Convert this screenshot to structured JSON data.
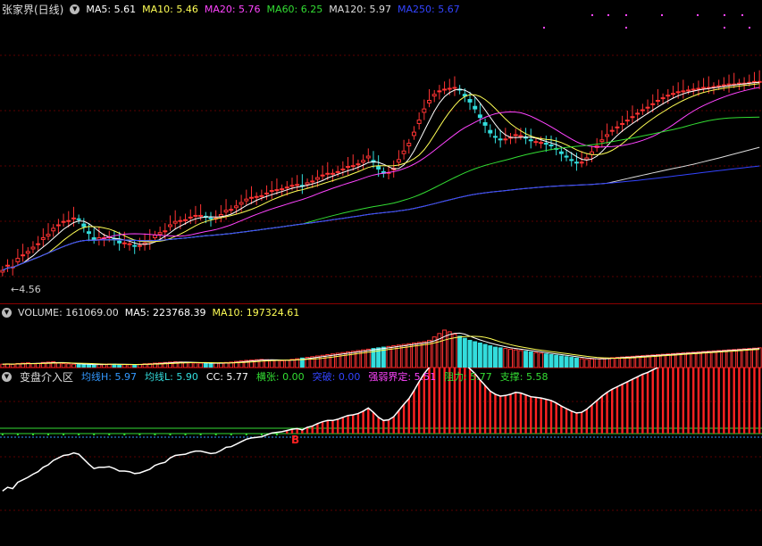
{
  "stock": {
    "title": "张家界(日线)",
    "ma": [
      {
        "label": "MA5:",
        "value": "5.61",
        "color": "#ffffff"
      },
      {
        "label": "MA10:",
        "value": "5.46",
        "color": "#ffff55"
      },
      {
        "label": "MA20:",
        "value": "5.76",
        "color": "#ff44ff"
      },
      {
        "label": "MA60:",
        "value": "6.25",
        "color": "#33dd33"
      },
      {
        "label": "MA120:",
        "value": "5.97",
        "color": "#dddddd"
      },
      {
        "label": "MA250:",
        "value": "5.67",
        "color": "#3344ff"
      }
    ],
    "low_label": "4.56"
  },
  "volume": {
    "title": "VOLUME:",
    "value": "161069.00",
    "ma5_label": "MA5:",
    "ma5_value": "223768.39",
    "ma10_label": "MA10:",
    "ma10_value": "197324.61"
  },
  "indicator": {
    "title": "变盘介入区",
    "items": [
      {
        "label": "均线H:",
        "value": "5.97",
        "color": "#3399ff"
      },
      {
        "label": "均线L:",
        "value": "5.90",
        "color": "#33dddd"
      },
      {
        "label": "CC:",
        "value": "5.77",
        "color": "#ffffff"
      },
      {
        "label": "横张:",
        "value": "0.00",
        "color": "#33dd33"
      },
      {
        "label": "突破:",
        "value": "0.00",
        "color": "#3344ff"
      },
      {
        "label": "强弱界定:",
        "value": "5.51",
        "color": "#ff44ff"
      },
      {
        "label": "阻力:",
        "value": "5.77",
        "color": "#33dd33"
      },
      {
        "label": "支撑:",
        "value": "5.58",
        "color": "#33dd33"
      }
    ],
    "signal_label": "B"
  },
  "chart_data": {
    "type": "candlestick",
    "x": [
      0,
      1,
      2,
      3,
      4,
      5,
      6,
      7,
      8,
      9,
      10,
      11,
      12,
      13,
      14,
      15,
      16,
      17,
      18,
      19,
      20,
      21,
      22,
      23,
      24,
      25,
      26,
      27,
      28,
      29,
      30,
      31,
      32,
      33,
      34,
      35,
      36,
      37,
      38,
      39,
      40,
      41,
      42,
      43,
      44,
      45,
      46,
      47,
      48,
      49,
      50,
      51,
      52,
      53,
      54,
      55,
      56,
      57,
      58,
      59,
      60,
      61,
      62,
      63,
      64,
      65,
      66,
      67,
      68,
      69,
      70,
      71,
      72,
      73,
      74,
      75,
      76,
      77,
      78,
      79,
      80,
      81,
      82,
      83,
      84,
      85,
      86,
      87,
      88,
      89,
      90,
      91,
      92,
      93,
      94,
      95,
      96,
      97,
      98,
      99,
      100,
      101,
      102,
      103,
      104,
      105,
      106,
      107,
      108,
      109,
      110,
      111,
      112,
      113,
      114,
      115,
      116,
      117,
      118,
      119,
      120,
      121,
      122,
      123,
      124,
      125,
      126,
      127,
      128,
      129,
      130,
      131,
      132,
      133,
      134,
      135,
      136,
      137,
      138,
      139,
      140,
      141,
      142,
      143,
      144,
      145,
      146,
      147,
      148,
      149
    ],
    "close": [
      4.68,
      4.74,
      4.72,
      4.82,
      4.86,
      4.9,
      4.95,
      4.99,
      5.06,
      5.1,
      5.17,
      5.21,
      5.25,
      5.26,
      5.29,
      5.27,
      5.19,
      5.11,
      5.04,
      5.06,
      5.06,
      5.07,
      5.04,
      5.0,
      5.0,
      4.99,
      4.96,
      4.97,
      5.0,
      5.03,
      5.09,
      5.12,
      5.14,
      5.21,
      5.25,
      5.26,
      5.27,
      5.3,
      5.32,
      5.32,
      5.3,
      5.28,
      5.29,
      5.33,
      5.38,
      5.39,
      5.43,
      5.47,
      5.51,
      5.53,
      5.54,
      5.55,
      5.58,
      5.61,
      5.62,
      5.63,
      5.65,
      5.67,
      5.68,
      5.66,
      5.7,
      5.72,
      5.76,
      5.79,
      5.81,
      5.81,
      5.83,
      5.86,
      5.89,
      5.9,
      5.92,
      5.96,
      6.01,
      5.94,
      5.86,
      5.81,
      5.82,
      5.87,
      5.97,
      6.07,
      6.16,
      6.29,
      6.43,
      6.56,
      6.66,
      6.73,
      6.77,
      6.79,
      6.8,
      6.81,
      6.78,
      6.71,
      6.64,
      6.56,
      6.46,
      6.37,
      6.28,
      6.23,
      6.2,
      6.21,
      6.23,
      6.26,
      6.25,
      6.22,
      6.19,
      6.18,
      6.17,
      6.15,
      6.13,
      6.09,
      6.04,
      6.0,
      5.96,
      5.93,
      5.94,
      5.99,
      6.06,
      6.13,
      6.2,
      6.26,
      6.31,
      6.35,
      6.39,
      6.43,
      6.47,
      6.51,
      6.55,
      6.58,
      6.62,
      6.66,
      6.69,
      6.72,
      6.74,
      6.76,
      6.77,
      6.78,
      6.79,
      6.8,
      6.81,
      6.81,
      6.82,
      6.83,
      6.84,
      6.85,
      6.85,
      6.86,
      6.86,
      6.87,
      6.88,
      6.88
    ],
    "open": [
      4.66,
      4.73,
      4.71,
      4.78,
      4.85,
      4.88,
      4.93,
      4.98,
      5.04,
      5.08,
      5.14,
      5.2,
      5.24,
      5.25,
      5.28,
      5.28,
      5.22,
      5.13,
      5.06,
      5.04,
      5.05,
      5.06,
      5.05,
      5.02,
      4.99,
      4.98,
      4.97,
      4.96,
      4.98,
      5.01,
      5.06,
      5.1,
      5.13,
      5.19,
      5.23,
      5.25,
      5.26,
      5.29,
      5.31,
      5.31,
      5.31,
      5.29,
      5.28,
      5.31,
      5.36,
      5.38,
      5.41,
      5.45,
      5.49,
      5.52,
      5.53,
      5.54,
      5.57,
      5.6,
      5.61,
      5.62,
      5.64,
      5.66,
      5.67,
      5.67,
      5.68,
      5.71,
      5.74,
      5.78,
      5.8,
      5.8,
      5.82,
      5.85,
      5.88,
      5.89,
      5.91,
      5.94,
      5.99,
      5.96,
      5.89,
      5.83,
      5.81,
      5.85,
      5.94,
      6.04,
      6.13,
      6.25,
      6.39,
      6.52,
      6.63,
      6.71,
      6.76,
      6.78,
      6.79,
      6.8,
      6.79,
      6.73,
      6.67,
      6.59,
      6.49,
      6.4,
      6.31,
      6.24,
      6.21,
      6.2,
      6.22,
      6.25,
      6.25,
      6.23,
      6.2,
      6.18,
      6.17,
      6.16,
      6.14,
      6.1,
      6.06,
      6.01,
      5.97,
      5.94,
      5.93,
      5.97,
      6.03,
      6.11,
      6.18,
      6.24,
      6.3,
      6.34,
      6.38,
      6.42,
      6.46,
      6.5,
      6.54,
      6.57,
      6.61,
      6.65,
      6.68,
      6.71,
      6.73,
      6.75,
      6.77,
      6.78,
      6.79,
      6.8,
      6.8,
      6.81,
      6.82,
      6.83,
      6.84,
      6.84,
      6.85,
      6.85,
      6.86,
      6.87,
      6.87,
      6.88
    ],
    "volume": [
      100,
      110,
      95,
      120,
      130,
      140,
      115,
      125,
      150,
      160,
      170,
      130,
      120,
      110,
      100,
      95,
      90,
      85,
      80,
      95,
      100,
      105,
      98,
      92,
      88,
      85,
      90,
      95,
      110,
      120,
      130,
      140,
      150,
      160,
      170,
      165,
      150,
      140,
      135,
      130,
      125,
      120,
      130,
      140,
      150,
      160,
      180,
      200,
      210,
      220,
      230,
      240,
      230,
      220,
      210,
      200,
      220,
      240,
      260,
      280,
      300,
      320,
      340,
      360,
      380,
      400,
      420,
      440,
      460,
      480,
      500,
      520,
      540,
      560,
      580,
      600,
      620,
      640,
      660,
      680,
      700,
      720,
      740,
      760,
      800,
      900,
      1000,
      1100,
      1050,
      980,
      920,
      860,
      800,
      760,
      720,
      680,
      640,
      600,
      580,
      560,
      540,
      520,
      500,
      480,
      460,
      440,
      420,
      400,
      380,
      360,
      340,
      320,
      300,
      280,
      260,
      240,
      250,
      260,
      270,
      280,
      290,
      300,
      310,
      320,
      330,
      340,
      350,
      360,
      370,
      380,
      390,
      400,
      410,
      420,
      430,
      440,
      450,
      460,
      470,
      480,
      490,
      500,
      510,
      520,
      530,
      540,
      550,
      560,
      570,
      580
    ],
    "ylim": [
      4.4,
      7.6
    ]
  }
}
